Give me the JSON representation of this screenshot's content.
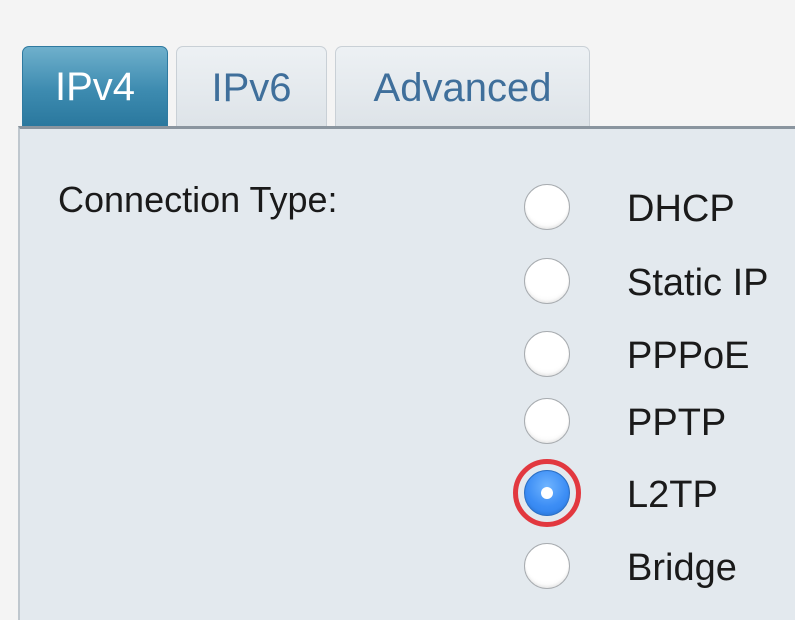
{
  "tabs": [
    {
      "label": "IPv4",
      "active": true
    },
    {
      "label": "IPv6",
      "active": false
    },
    {
      "label": "Advanced",
      "active": false
    }
  ],
  "connection": {
    "label": "Connection Type:",
    "selected": "L2TP",
    "options": [
      {
        "label": "DHCP",
        "checked": false
      },
      {
        "label": "Static IP",
        "checked": false
      },
      {
        "label": "PPPoE",
        "checked": false
      },
      {
        "label": "PPTP",
        "checked": false
      },
      {
        "label": "L2TP",
        "checked": true
      },
      {
        "label": "Bridge",
        "checked": false
      }
    ]
  },
  "colors": {
    "active_tab": "#3d8bb0",
    "inactive_tab_text": "#3f6f9b",
    "panel_background": "#e3e9ee",
    "selected_radio": "#3d8ef5",
    "highlight_ring": "#e2383f"
  }
}
